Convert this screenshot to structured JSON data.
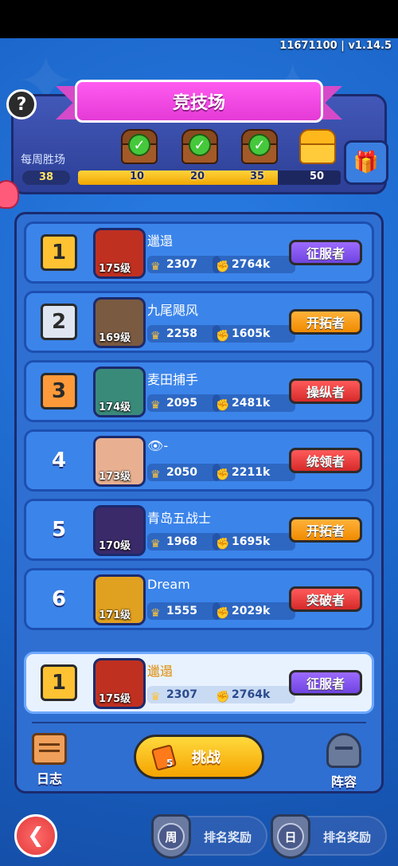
{
  "version": "11671100 | v1.14.5",
  "header": {
    "title": "竞技场",
    "help_label": "?",
    "weekly_label": "每周胜场",
    "weekly_wins": "38",
    "progress_fraction": 0.76,
    "milestones": [
      {
        "value": "10",
        "claimed": true
      },
      {
        "value": "20",
        "claimed": true
      },
      {
        "value": "35",
        "claimed": true
      },
      {
        "value": "50",
        "claimed": false
      }
    ]
  },
  "ranking": [
    {
      "rank": "1",
      "name": "邋遢",
      "level": "175级",
      "trophies": "2307",
      "power": "2764k",
      "title": "征服者",
      "title_color": "purple",
      "rank_style": "gold",
      "avatar_color": "#c03020"
    },
    {
      "rank": "2",
      "name": "九尾飓风",
      "level": "169级",
      "trophies": "2258",
      "power": "1605k",
      "title": "开拓者",
      "title_color": "orange",
      "rank_style": "silver",
      "avatar_color": "#7a5a40"
    },
    {
      "rank": "3",
      "name": "麦田捕手",
      "level": "174级",
      "trophies": "2095",
      "power": "2481k",
      "title": "操纵者",
      "title_color": "red",
      "rank_style": "bronze",
      "avatar_color": "#3a8a7a"
    },
    {
      "rank": "4",
      "name": "👁-",
      "level": "173级",
      "trophies": "2050",
      "power": "2211k",
      "title": "统领者",
      "title_color": "red",
      "rank_style": "plain",
      "avatar_color": "#e8b090"
    },
    {
      "rank": "5",
      "name": "青岛五战士",
      "level": "170级",
      "trophies": "1968",
      "power": "1695k",
      "title": "开拓者",
      "title_color": "orange",
      "rank_style": "plain",
      "avatar_color": "#3a2a6a"
    },
    {
      "rank": "6",
      "name": "Dream",
      "level": "171级",
      "trophies": "1555",
      "power": "2029k",
      "title": "突破者",
      "title_color": "red",
      "rank_style": "plain",
      "avatar_color": "#e0a020"
    }
  ],
  "me": {
    "rank": "1",
    "name": "邋遢",
    "level": "175级",
    "trophies": "2307",
    "power": "2764k",
    "title": "征服者"
  },
  "actions": {
    "log_label": "日志",
    "challenge_label": "挑战",
    "ticket_count": "5",
    "lineup_label": "阵容"
  },
  "footer": {
    "back_icon": "back-arrow-icon",
    "weekly_reward_badge": "周",
    "weekly_reward_label": "排名奖励",
    "daily_reward_badge": "日",
    "daily_reward_label": "排名奖励"
  }
}
